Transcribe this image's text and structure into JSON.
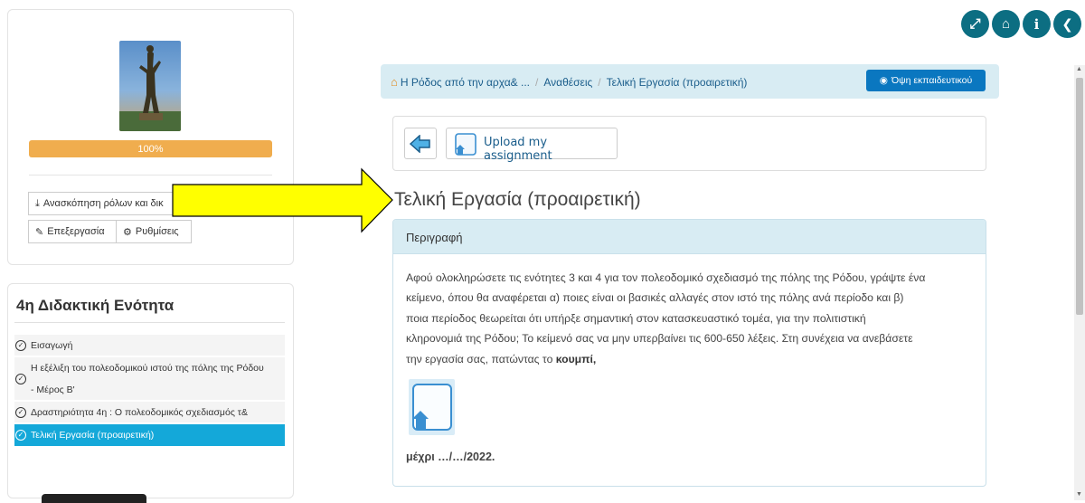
{
  "sidebar": {
    "progress": {
      "label": "100%",
      "percent": 100
    },
    "buttons": {
      "roles": "Ανασκόπηση ρόλων και δικ",
      "edit": "Επεξεργασία",
      "settings": "Ρυθμίσεις"
    },
    "unit_title": "4η Διδακτική Ενότητα",
    "lessons": [
      {
        "label_line1": "Εισαγωγή",
        "label_line2": ""
      },
      {
        "label_line1": "Η εξέλιξη του πολεοδομικού ιστού της πόλης της Ρόδου",
        "label_line2": "- Μέρος Β'"
      },
      {
        "label_line1": "Δραστηριότητα 4η : Ο πολεοδομικός σχεδιασμός τ&",
        "label_line2": ""
      },
      {
        "label_line1": "Τελική Εργασία (προαιρετική)",
        "label_line2": ""
      }
    ]
  },
  "breadcrumb": {
    "items": [
      "Η Ρόδος από την αρχα& ...",
      "Αναθέσεις",
      "Τελική Εργασία (προαιρετική)"
    ],
    "teacher_view": "Όψη εκπαιδευτικού"
  },
  "toolbar": {
    "upload_label": "Upload my assignment"
  },
  "page": {
    "heading": "Τελική Εργασία (προαιρετική)",
    "panel_title": "Περιγραφή",
    "description_lines": [
      "Αφού ολοκληρώσετε τις ενότητες 3 και 4 για τον πολεοδομικό σχεδιασμό της πόλης της Ρόδου, γράψτε ένα",
      "κείμενο, όπου θα αναφέρεται  α) ποιες είναι οι βασικές αλλαγές στον ιστό της πόλης ανά περίοδο και β)",
      "ποια περίοδος θεωρείται ότι υπήρξε σημαντική στον κατασκευαστικό τομέα,  για την πολιτιστική",
      "κληρονομιά της Ρόδου; Το κείμενό σας να μην υπερβαίνει τις 600-650 λέξεις. Στη συνέχεια να ανεβάσετε"
    ],
    "description_last_prefix": "την εργασία σας, πατώντας το ",
    "description_last_bold": "κουμπί,",
    "deadline": "μέχρι …/…/2022."
  },
  "colors": {
    "accent": "#0c6e82",
    "breadcrumb_bg": "#d8ecf3",
    "progress": "#f0ad4e",
    "active_lesson": "#14a8d9",
    "teacher_button": "#0a77c0",
    "annotation_arrow": "#ffff00"
  }
}
